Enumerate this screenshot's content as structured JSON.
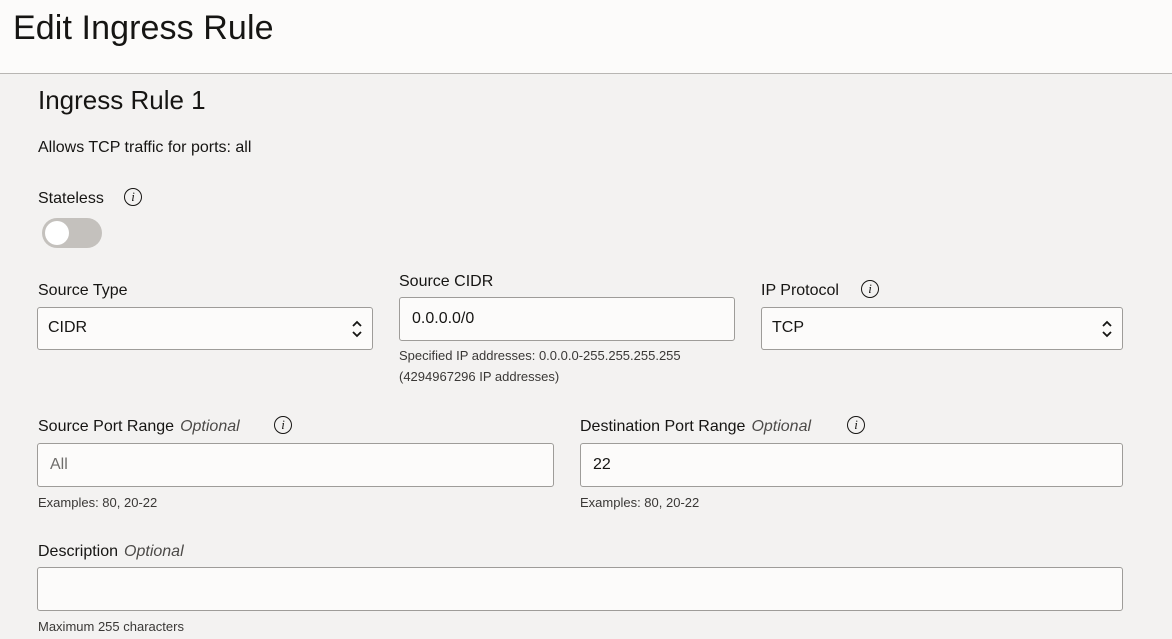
{
  "header": {
    "title": "Edit Ingress Rule"
  },
  "rule": {
    "title": "Ingress Rule 1",
    "summary": "Allows TCP traffic for ports: all",
    "stateless": {
      "label": "Stateless",
      "enabled": false,
      "info_icon": "info-icon"
    },
    "source_type": {
      "label": "Source Type",
      "value": "CIDR"
    },
    "source_cidr": {
      "label": "Source CIDR",
      "value": "0.0.0.0/0",
      "hint_line1": "Specified IP addresses: 0.0.0.0-255.255.255.255",
      "hint_line2": "(4294967296 IP addresses)"
    },
    "ip_protocol": {
      "label": "IP Protocol",
      "value": "TCP",
      "info_icon": "info-icon"
    },
    "source_port_range": {
      "label": "Source Port Range",
      "optional": "Optional",
      "value": "",
      "placeholder": "All",
      "hint": "Examples: 80, 20-22"
    },
    "destination_port_range": {
      "label": "Destination Port Range",
      "optional": "Optional",
      "value": "22",
      "placeholder": "",
      "hint": "Examples: 80, 20-22"
    },
    "description": {
      "label": "Description",
      "optional": "Optional",
      "value": "",
      "hint": "Maximum 255 characters"
    }
  }
}
